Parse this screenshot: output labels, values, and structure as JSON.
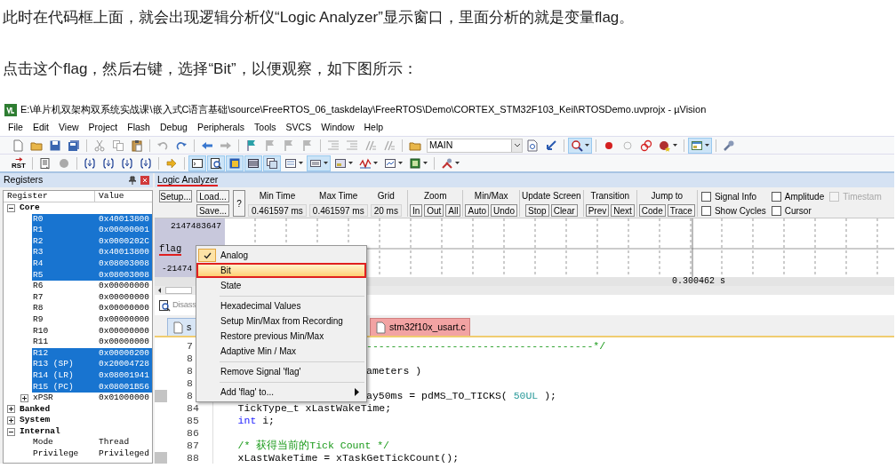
{
  "paragraphs": [
    "此时在代码框上面，就会出现逻辑分析仪“Logic Analyzer”显示窗口，里面分析的就是变量flag。",
    "点击这个flag，然后右键，选择“Bit”，以便观察，如下图所示："
  ],
  "window": {
    "title": "E:\\单片机双架构双系统实战课\\嵌入式C语言基础\\source\\FreeRTOS_06_taskdelay\\FreeRTOS\\Demo\\CORTEX_STM32F103_Keil\\RTOSDemo.uvprojx - µVision"
  },
  "menu_bar": [
    "File",
    "Edit",
    "View",
    "Project",
    "Flash",
    "Debug",
    "Peripherals",
    "Tools",
    "SVCS",
    "Window",
    "Help"
  ],
  "toolbar_1": [
    {
      "kind": "button",
      "on": false,
      "menu": false
    },
    {
      "kind": "button",
      "on": false,
      "menu": false
    },
    {
      "kind": "button",
      "on": false,
      "menu": false
    },
    {
      "kind": "button",
      "on": false,
      "menu": false
    },
    {
      "kind": "separator"
    },
    {
      "kind": "button",
      "on": false,
      "menu": false
    },
    {
      "kind": "button",
      "on": false,
      "menu": false
    },
    {
      "kind": "button",
      "on": false,
      "menu": false
    },
    {
      "kind": "separator"
    },
    {
      "kind": "button",
      "on": false,
      "menu": false
    },
    {
      "kind": "button",
      "on": false,
      "menu": false
    },
    {
      "kind": "separator"
    },
    {
      "kind": "button",
      "on": false,
      "menu": false
    },
    {
      "kind": "button",
      "on": false,
      "menu": false
    },
    {
      "kind": "separator"
    },
    {
      "kind": "button",
      "on": false,
      "menu": false
    },
    {
      "kind": "button",
      "on": false,
      "menu": false
    },
    {
      "kind": "button",
      "on": false,
      "menu": false
    },
    {
      "kind": "button",
      "on": false,
      "menu": false
    },
    {
      "kind": "separator"
    },
    {
      "kind": "button",
      "on": false,
      "menu": false
    },
    {
      "kind": "button",
      "on": false,
      "menu": false
    },
    {
      "kind": "button",
      "on": false,
      "menu": false
    },
    {
      "kind": "button",
      "on": false,
      "menu": false
    },
    {
      "kind": "separator"
    },
    {
      "kind": "button",
      "on": false,
      "menu": false
    },
    {
      "kind": "select",
      "value": "MAIN"
    },
    {
      "kind": "button",
      "on": false,
      "menu": false
    },
    {
      "kind": "button",
      "on": false,
      "menu": false
    },
    {
      "kind": "separator"
    },
    {
      "kind": "button",
      "on": true,
      "menu": true
    },
    {
      "kind": "separator"
    },
    {
      "kind": "button",
      "on": false,
      "menu": false
    },
    {
      "kind": "button",
      "on": false,
      "menu": false
    },
    {
      "kind": "button",
      "on": false,
      "menu": false
    },
    {
      "kind": "button",
      "on": false,
      "menu": true
    },
    {
      "kind": "separator"
    },
    {
      "kind": "button",
      "on": true,
      "menu": true
    },
    {
      "kind": "separator"
    },
    {
      "kind": "button",
      "on": false,
      "menu": false
    }
  ],
  "toolbar_2": [
    {
      "kind": "button",
      "label": "RST",
      "on": false,
      "menu": false
    },
    {
      "kind": "separator"
    },
    {
      "kind": "button",
      "on": false,
      "menu": false
    },
    {
      "kind": "button",
      "on": false,
      "menu": false
    },
    {
      "kind": "separator"
    },
    {
      "kind": "button",
      "on": false,
      "menu": false
    },
    {
      "kind": "button",
      "on": false,
      "menu": false
    },
    {
      "kind": "button",
      "on": false,
      "menu": false
    },
    {
      "kind": "button",
      "on": false,
      "menu": false
    },
    {
      "kind": "separator"
    },
    {
      "kind": "button",
      "on": false,
      "menu": false
    },
    {
      "kind": "separator"
    },
    {
      "kind": "button",
      "on": true,
      "menu": false
    },
    {
      "kind": "button",
      "on": true,
      "menu": false
    },
    {
      "kind": "button",
      "on": true,
      "menu": false
    },
    {
      "kind": "button",
      "on": true,
      "menu": false
    },
    {
      "kind": "button",
      "on": true,
      "menu": false
    },
    {
      "kind": "button",
      "on": false,
      "menu": true
    },
    {
      "kind": "button",
      "on": true,
      "menu": true
    },
    {
      "kind": "button",
      "on": false,
      "menu": true
    },
    {
      "kind": "button",
      "on": false,
      "menu": true
    },
    {
      "kind": "button",
      "on": false,
      "menu": true
    },
    {
      "kind": "button",
      "on": false,
      "menu": true
    },
    {
      "kind": "separator"
    },
    {
      "kind": "button",
      "on": false,
      "menu": true
    }
  ],
  "registers": {
    "title": "Registers",
    "columns": [
      "Register",
      "Value"
    ],
    "tree": [
      {
        "name": "Core",
        "expanded": true,
        "selected": false,
        "children": [
          {
            "name": "R0",
            "value": "0x40013800",
            "selected": true
          },
          {
            "name": "R1",
            "value": "0x00000001",
            "selected": true
          },
          {
            "name": "R2",
            "value": "0x0000202C",
            "selected": true
          },
          {
            "name": "R3",
            "value": "0x40013800",
            "selected": true
          },
          {
            "name": "R4",
            "value": "0x08003008",
            "selected": true
          },
          {
            "name": "R5",
            "value": "0x08003008",
            "selected": true
          },
          {
            "name": "R6",
            "value": "0x00000000",
            "selected": false
          },
          {
            "name": "R7",
            "value": "0x00000000",
            "selected": false
          },
          {
            "name": "R8",
            "value": "0x00000000",
            "selected": false
          },
          {
            "name": "R9",
            "value": "0x00000000",
            "selected": false
          },
          {
            "name": "R10",
            "value": "0x00000000",
            "selected": false
          },
          {
            "name": "R11",
            "value": "0x00000000",
            "selected": false
          },
          {
            "name": "R12",
            "value": "0x00000200",
            "selected": true
          },
          {
            "name": "R13 (SP)",
            "value": "0x20004728",
            "selected": true
          },
          {
            "name": "R14 (LR)",
            "value": "0x08001941",
            "selected": true
          },
          {
            "name": "R15 (PC)",
            "value": "0x08001B56",
            "selected": true
          },
          {
            "name": "xPSR",
            "value": "0x01000000",
            "selected": false,
            "expanded": false
          }
        ]
      },
      {
        "name": "Banked",
        "expanded": false,
        "selected": false
      },
      {
        "name": "System",
        "expanded": false,
        "selected": false
      },
      {
        "name": "Internal",
        "expanded": true,
        "selected": false,
        "children": [
          {
            "name": "Mode",
            "value": "Thread",
            "selected": false
          },
          {
            "name": "Privilege",
            "value": "Privileged",
            "selected": false
          }
        ]
      }
    ]
  },
  "logic_analyzer": {
    "tab": {
      "label": "Logic Analyzer",
      "annotated": true
    },
    "setup": "Setup...",
    "load": "Load...",
    "save": "Save...",
    "help": "?",
    "fields": [
      {
        "label": "Min Time",
        "value": "0.461597 ms"
      },
      {
        "label": "Max Time",
        "value": "0.461597 ms"
      },
      {
        "label": "Grid",
        "value": "20 ms"
      }
    ],
    "groups": [
      {
        "label": "Zoom",
        "buttons": [
          "In",
          "Out",
          "All"
        ]
      },
      {
        "label": "Min/Max",
        "buttons": [
          "Auto",
          "Undo"
        ]
      },
      {
        "label": "Update Screen",
        "buttons": [
          "Stop",
          "Clear"
        ]
      },
      {
        "label": "Transition",
        "buttons": [
          "Prev",
          "Next"
        ]
      },
      {
        "label": "Jump to",
        "buttons": [
          "Code",
          "Trace"
        ]
      }
    ],
    "checkboxes": [
      {
        "label": "Signal Info",
        "checked": false,
        "disabled": false
      },
      {
        "label": "Show Cycles",
        "checked": false,
        "disabled": false
      },
      {
        "label": "Amplitude",
        "checked": false,
        "disabled": false
      },
      {
        "label": "Cursor",
        "checked": false,
        "disabled": false
      },
      {
        "label": "Timestam",
        "checked": false,
        "disabled": true
      }
    ],
    "signal": {
      "max": "2147483647",
      "name": "flag",
      "min": "-21474",
      "annotated": true
    },
    "time_readout": "0.300462 s"
  },
  "context_menu": [
    {
      "kind": "item",
      "label": "Analog",
      "checked": true,
      "selected": false,
      "annotated": false
    },
    {
      "kind": "item",
      "label": "Bit",
      "checked": false,
      "selected": true,
      "annotated": true
    },
    {
      "kind": "item",
      "label": "State",
      "checked": false,
      "selected": false,
      "annotated": false
    },
    {
      "kind": "separator"
    },
    {
      "kind": "item",
      "label": "Hexadecimal Values",
      "checked": false,
      "selected": false,
      "annotated": false
    },
    {
      "kind": "item",
      "label": "Setup Min/Max from Recording",
      "checked": false,
      "selected": false,
      "annotated": false
    },
    {
      "kind": "item",
      "label": "Restore previous Min/Max",
      "checked": false,
      "selected": false,
      "annotated": false
    },
    {
      "kind": "item",
      "label": "Adaptive Min / Max",
      "checked": false,
      "selected": false,
      "annotated": false
    },
    {
      "kind": "separator"
    },
    {
      "kind": "item",
      "label": "Remove Signal 'flag'",
      "checked": false,
      "selected": false,
      "annotated": false
    },
    {
      "kind": "separator"
    },
    {
      "kind": "submenu",
      "label": "Add 'flag' to...",
      "checked": false,
      "selected": false,
      "annotated": false
    }
  ],
  "disassembly_bar": {
    "label": "Disass"
  },
  "editor_tabs": [
    {
      "label": "s",
      "selected": true
    },
    {
      "label": "stm32f10x_usart.c",
      "selected": false
    }
  ],
  "code": [
    {
      "number": "7",
      "has_code": false,
      "segments": [
        {
          "kind": "comment",
          "text": "-------------------------------------*/"
        }
      ]
    },
    {
      "number": "8",
      "has_code": false
    },
    {
      "number": "8",
      "has_code": false,
      "segments": [
        {
          "kind": "plain",
          "text": "ameters )"
        }
      ]
    },
    {
      "number": "8",
      "has_code": false
    },
    {
      "number": "8",
      "has_code": true,
      "segments": [
        {
          "kind": "plain",
          "text": "ay50ms = pdMS_TO_TICKS( "
        },
        {
          "kind": "number",
          "text": "50UL"
        },
        {
          "kind": "plain",
          "text": " );"
        }
      ]
    },
    {
      "number": "84",
      "has_code": false,
      "segments": [
        {
          "kind": "plain",
          "text": "    TickType_t xLastWakeTime;"
        }
      ]
    },
    {
      "number": "85",
      "has_code": false,
      "segments": [
        {
          "kind": "keyword",
          "text": "    int"
        },
        {
          "kind": "plain",
          "text": " i;"
        }
      ]
    },
    {
      "number": "86",
      "has_code": false
    },
    {
      "number": "87",
      "has_code": false,
      "segments": [
        {
          "kind": "comment",
          "text": "    /* 获得当前的Tick Count */"
        }
      ]
    },
    {
      "number": "88",
      "has_code": true,
      "segments": [
        {
          "kind": "plain",
          "text": "    xLastWakeTime = xTaskGetTickCount();"
        }
      ]
    }
  ]
}
